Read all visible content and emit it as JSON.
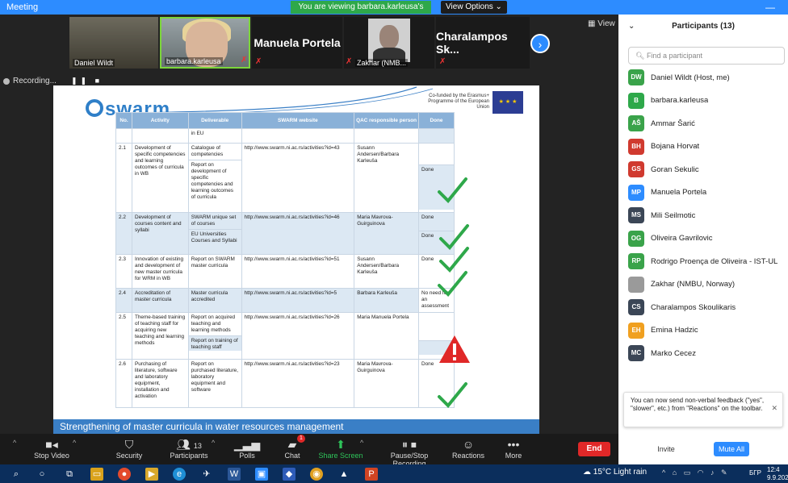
{
  "window": {
    "title": "Meeting",
    "share_banner": "You are viewing barbara.karleusa's screen",
    "view_options": "View Options ⌄",
    "minimize": "—"
  },
  "thumbs": {
    "daniel": "Daniel Wildt",
    "barbara": "barbara.karleusa",
    "manuela": "Manuela Portela",
    "zakhar": "Zakhar (NMB...",
    "charalampos": "Charalampos Sk...",
    "view_label": "View"
  },
  "recording": {
    "label": "Recording...",
    "controls": "❚❚ ■"
  },
  "slide": {
    "logo": "swarm",
    "eu_text": "Co-funded by the Erasmus+ Programme of the European Union",
    "footer": "Strengthening of master curricula in water resources management",
    "headers": [
      "No.",
      "Activity",
      "Deliverable",
      "SWARM website",
      "QAC responsible person",
      "Done"
    ],
    "rows": [
      {
        "no": "",
        "activity": "",
        "deliverables": [
          "in EU"
        ],
        "website": "",
        "person": "",
        "done": [
          ""
        ]
      },
      {
        "no": "2.1",
        "activity": "Development of specific competencies and learning outcomes of curricula in WB",
        "deliverables": [
          "Catalogue of competencies",
          "Report on development of specific competencies and learning outcomes of curricula"
        ],
        "website": "http://www.swarm.ni.ac.rs/activities?id=43",
        "person": "Susann Andersen/Barbara Karleuša",
        "done": [
          "",
          "Done"
        ]
      },
      {
        "no": "2.2",
        "activity": "Development of courses content and syllabi",
        "deliverables": [
          "SWARM unique set of courses",
          "EU Universities Courses and Syllabi"
        ],
        "website": "http://www.swarm.ni.ac.rs/activities?id=46",
        "person": "Maria Mavrova-Guirguinova",
        "done": [
          "Done",
          "Done"
        ]
      },
      {
        "no": "2.3",
        "activity": "Innovation of existing and development of new master curricula for WRM in WB",
        "deliverables": [
          "Report on SWARM master curricula"
        ],
        "website": "http://www.swarm.ni.ac.rs/activities?id=51",
        "person": "Susann Andersen/Barbara Karleuša",
        "done": [
          "Done"
        ]
      },
      {
        "no": "2.4",
        "activity": "Accreditation of master curricula",
        "deliverables": [
          "Master curricula accredited"
        ],
        "website": "http://www.swarm.ni.ac.rs/activities?id=5",
        "person": "Barbara Karleuša",
        "done": [
          "No need for an assessment"
        ]
      },
      {
        "no": "2.5",
        "activity": "Theme-based training of teaching staff for acquiring new teaching and learning methods",
        "deliverables": [
          "Report on acquired teaching and learning methods",
          "Report on training of teaching staff"
        ],
        "website": "http://www.swarm.ni.ac.rs/activities?id=26",
        "person": "Maria Manuela Portela",
        "done": [
          "",
          ""
        ]
      },
      {
        "no": "2.6",
        "activity": "Purchasing of literature, software and laboratory equipment, installation and activation",
        "deliverables": [
          "Report on purchased literature, laboratory equipment and software"
        ],
        "website": "http://www.swarm.ni.ac.rs/activities?id=23",
        "person": "Maria Mavrova-Guirguinova",
        "done": [
          "Done"
        ]
      }
    ]
  },
  "participants": {
    "title": "Participants (13)",
    "chevron": "⌄",
    "search_placeholder": "Find a participant",
    "list": [
      {
        "initials": "DW",
        "name": "Daniel Wildt (Host, me)",
        "color": "#3aa34a"
      },
      {
        "initials": "B",
        "name": "barbara.karleusa",
        "color": "#2ea84a"
      },
      {
        "initials": "AŠ",
        "name": "Ammar Šarić",
        "color": "#3aa34a"
      },
      {
        "initials": "BH",
        "name": "Bojana Horvat",
        "color": "#d03a2f"
      },
      {
        "initials": "GS",
        "name": "Goran Sekulic",
        "color": "#d03a2f"
      },
      {
        "initials": "MP",
        "name": "Manuela Portela",
        "color": "#2d8cff"
      },
      {
        "initials": "MS",
        "name": "Mili Seilmotic",
        "color": "#3b4656"
      },
      {
        "initials": "OG",
        "name": "Oliveira Gavrilovic",
        "color": "#3aa34a"
      },
      {
        "initials": "RP",
        "name": "Rodrigo Proença de Oliveira - IST-UL",
        "color": "#3aa34a"
      },
      {
        "initials": "",
        "name": "Zakhar (NMBU, Norway)",
        "color": "#9a9a9a"
      },
      {
        "initials": "CS",
        "name": "Charalampos Skoulikaris",
        "color": "#3b4656"
      },
      {
        "initials": "EH",
        "name": "Emina Hadzic",
        "color": "#f0a020"
      },
      {
        "initials": "MC",
        "name": "Marko Cecez",
        "color": "#3b4656"
      }
    ],
    "feedback_tip": "You can now send non-verbal feedback (\"yes\", \"slower\", etc.) from \"Reactions\" on the toolbar.",
    "tip_close": "✕",
    "invite": "Invite",
    "mute_all": "Mute All"
  },
  "toolbar": {
    "stop_video": "Stop Video",
    "security": "Security",
    "participants": "Participants",
    "participants_count": "13",
    "polls": "Polls",
    "chat": "Chat",
    "chat_badge": "1",
    "share_screen": "Share Screen",
    "pause_stop": "Pause/Stop Recording",
    "reactions": "Reactions",
    "more": "More",
    "end": "End"
  },
  "taskbar": {
    "weather": "15°C  Light rain",
    "lang": "БГР",
    "time": "12:4",
    "date": "9.9.202"
  },
  "colors": {
    "zoom_blue": "#2d8cff",
    "check_green": "#2ea84a",
    "warn_red": "#e02828",
    "table_header": "#8ab1d8",
    "table_alt": "#dce8f3"
  }
}
